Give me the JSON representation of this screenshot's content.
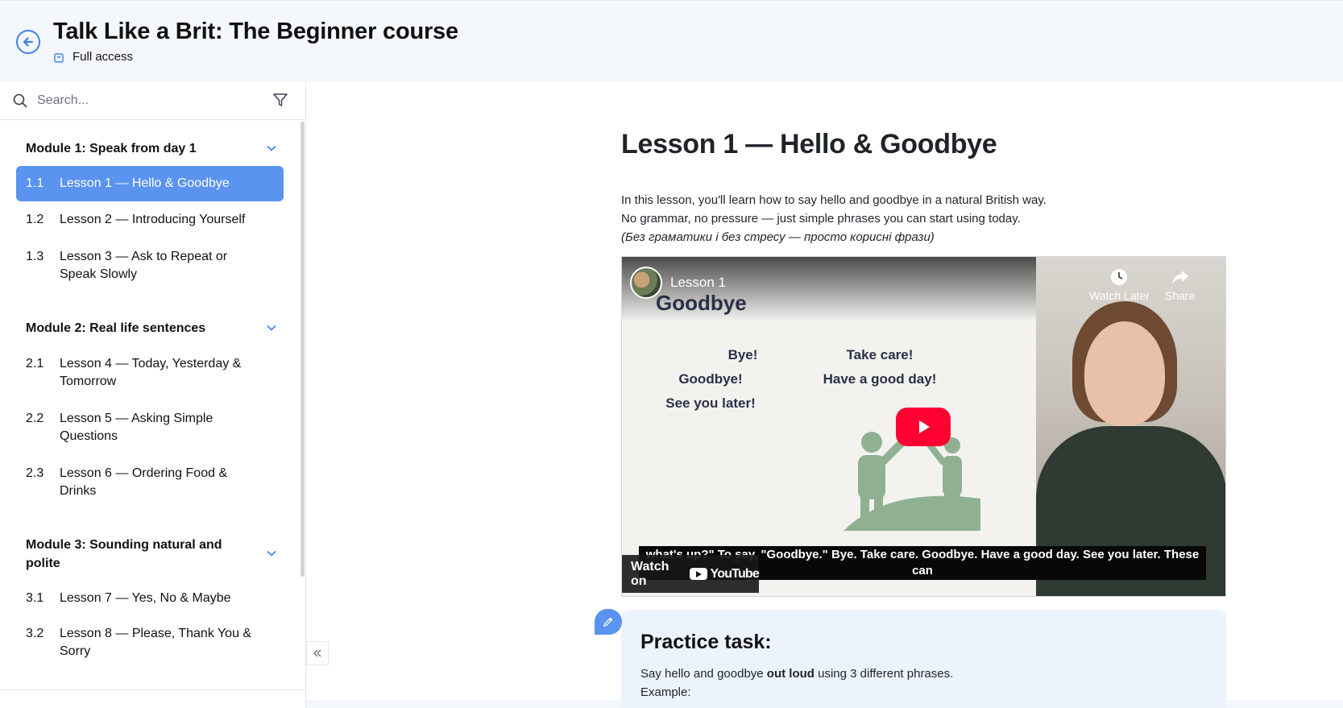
{
  "header": {
    "course_title": "Talk Like a Brit: The Beginner course",
    "access_label": "Full access"
  },
  "sidebar": {
    "search_placeholder": "Search...",
    "modules": [
      {
        "title": "Module 1: Speak from day 1",
        "lessons": [
          {
            "num": "1.1",
            "title": "Lesson 1 — Hello & Goodbye",
            "active": true
          },
          {
            "num": "1.2",
            "title": "Lesson 2 — Introducing Yourself"
          },
          {
            "num": "1.3",
            "title": "Lesson 3 — Ask to Repeat or Speak Slowly"
          }
        ]
      },
      {
        "title": "Module 2: Real life sentences",
        "lessons": [
          {
            "num": "2.1",
            "title": "Lesson 4 — Today, Yesterday & Tomorrow"
          },
          {
            "num": "2.2",
            "title": "Lesson 5 — Asking Simple Questions"
          },
          {
            "num": "2.3",
            "title": "Lesson 6 — Ordering Food & Drinks"
          }
        ]
      },
      {
        "title": "Module 3: Sounding natural and polite",
        "lessons": [
          {
            "num": "3.1",
            "title": "Lesson 7 — Yes, No & Maybe"
          },
          {
            "num": "3.2",
            "title": "Lesson 8 — Please, Thank You & Sorry"
          }
        ]
      }
    ]
  },
  "main": {
    "lesson_title": "Lesson 1 — Hello & Goodbye",
    "intro_lines": [
      "In this lesson, you'll learn how to say hello and goodbye in a natural British way.",
      "No grammar, no pressure — just simple phrases you can start using today."
    ],
    "intro_translation": "(Без граматики і без стресу — просто корисні фрази)",
    "video": {
      "label": "Lesson 1",
      "subtitle": "Goodbye",
      "phrases_left": [
        "Bye!",
        "Goodbye!",
        "See you later!"
      ],
      "phrases_right": [
        "Take care!",
        "Have a good day!"
      ],
      "watch_later": "Watch Later",
      "share": "Share",
      "captions": "what's up?\" To say, \"Goodbye.\" Bye. Take care. Goodbye. Have a good day. See you later. These can",
      "watch_on": "Watch on",
      "youtube": "YouTube"
    },
    "practice": {
      "title": "Practice task:",
      "text_before": "Say hello and goodbye ",
      "text_bold": "out loud",
      "text_after": " using 3 different phrases.",
      "example_label": "Example:"
    }
  },
  "colors": {
    "accent": "#5b93f0",
    "header_bg": "#f4f7fc",
    "practice_bg": "#edf3fd",
    "play_red": "#ff0033"
  }
}
